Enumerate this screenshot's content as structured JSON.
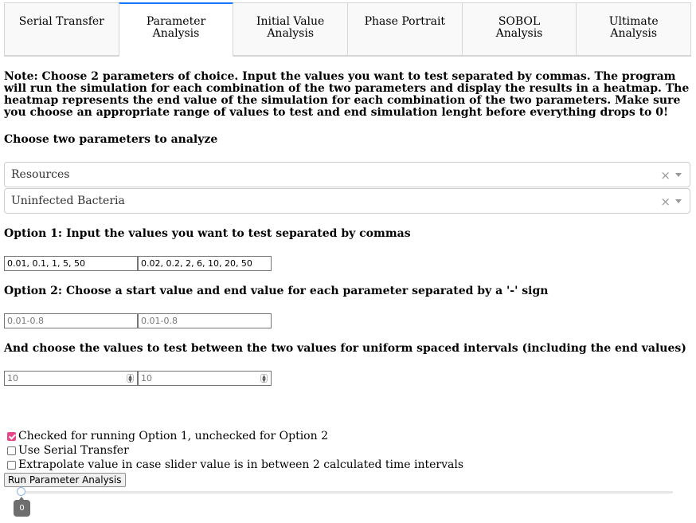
{
  "tabs": [
    {
      "label": "Serial Transfer"
    },
    {
      "label": "Parameter Analysis"
    },
    {
      "label": "Initial Value Analysis"
    },
    {
      "label": "Phase Portrait"
    },
    {
      "label": "SOBOL Analysis"
    },
    {
      "label": "Ultimate Analysis"
    }
  ],
  "active_tab": "Parameter Analysis",
  "note": "Note: Choose 2 parameters of choice. Input the values you want to test separated by commas. The program will run the simulation for each combination of the two parameters and display the results in a heatmap. The heatmap represents the end value of the simulation for each combination of the two parameters. Make sure you choose an appropriate range of values to test and end simulation lenght before everything drops to 0!",
  "choose_label": "Choose two parameters to analyze",
  "param1": {
    "value": "Resources",
    "clear": "×"
  },
  "param2": {
    "value": "Uninfected Bacteria",
    "clear": "×"
  },
  "option1": {
    "label": "Option 1: Input the values you want to test separated by commas",
    "values1": "0.01, 0.1, 1, 5, 50",
    "values2": "0.02, 0.2, 2, 6, 10, 20, 50"
  },
  "option2": {
    "label": "Option 2: Choose a start value and end value for each parameter separated by a '-' sign",
    "range1_placeholder": "0.01-0.8",
    "range2_placeholder": "0.01-0.8"
  },
  "intervals": {
    "label": "And choose the values to test between the two values for uniform spaced intervals (including the end values)",
    "n1": "10",
    "n2": "10"
  },
  "checkboxes": [
    {
      "label": "Checked for running Option 1, unchecked for Option 2",
      "checked": true
    },
    {
      "label": "Use Serial Transfer",
      "checked": false
    },
    {
      "label": "Extrapolate value in case slider value is in between 2 calculated time intervals",
      "checked": false
    }
  ],
  "run_button": "Run Parameter Analysis",
  "slider": {
    "value": "0",
    "fraction": 0
  }
}
